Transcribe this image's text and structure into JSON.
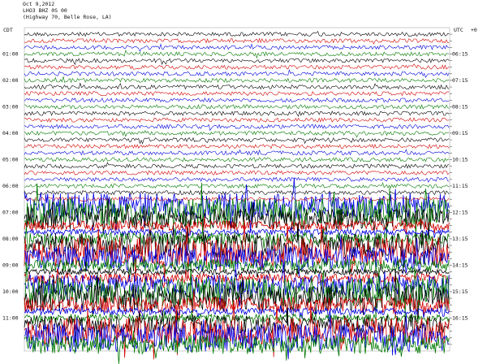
{
  "header": {
    "date": "Oct 9,2012",
    "station": "LHO3 BHZ 0S 00",
    "location": "(Highway 70, Belle Rose, LA)"
  },
  "chart_data": {
    "type": "line",
    "title": "",
    "left_axis_label": "CDT",
    "right_axis_label": "UTC",
    "right_axis_unit_label": "+0",
    "left_time_labels": [
      "01:00",
      "02:00",
      "03:00",
      "04:00",
      "05:00",
      "06:00",
      "07:00",
      "08:00",
      "09:00",
      "10:00",
      "11:00"
    ],
    "right_time_labels": [
      "06:15",
      "07:15",
      "08:15",
      "09:15",
      "10:15",
      "11:15",
      "12:15",
      "13:15",
      "14:15",
      "15:15",
      "16:15"
    ],
    "trace_colors": [
      "#000000",
      "#d40000",
      "#0000e0",
      "#007a00"
    ],
    "trace_count": 48,
    "traces_per_hour": 4,
    "minutes_per_trace": 15,
    "quiet_trace_amplitude": 2.5,
    "noise_onset_trace": 26,
    "noisy_trace_amplitude": 18
  }
}
